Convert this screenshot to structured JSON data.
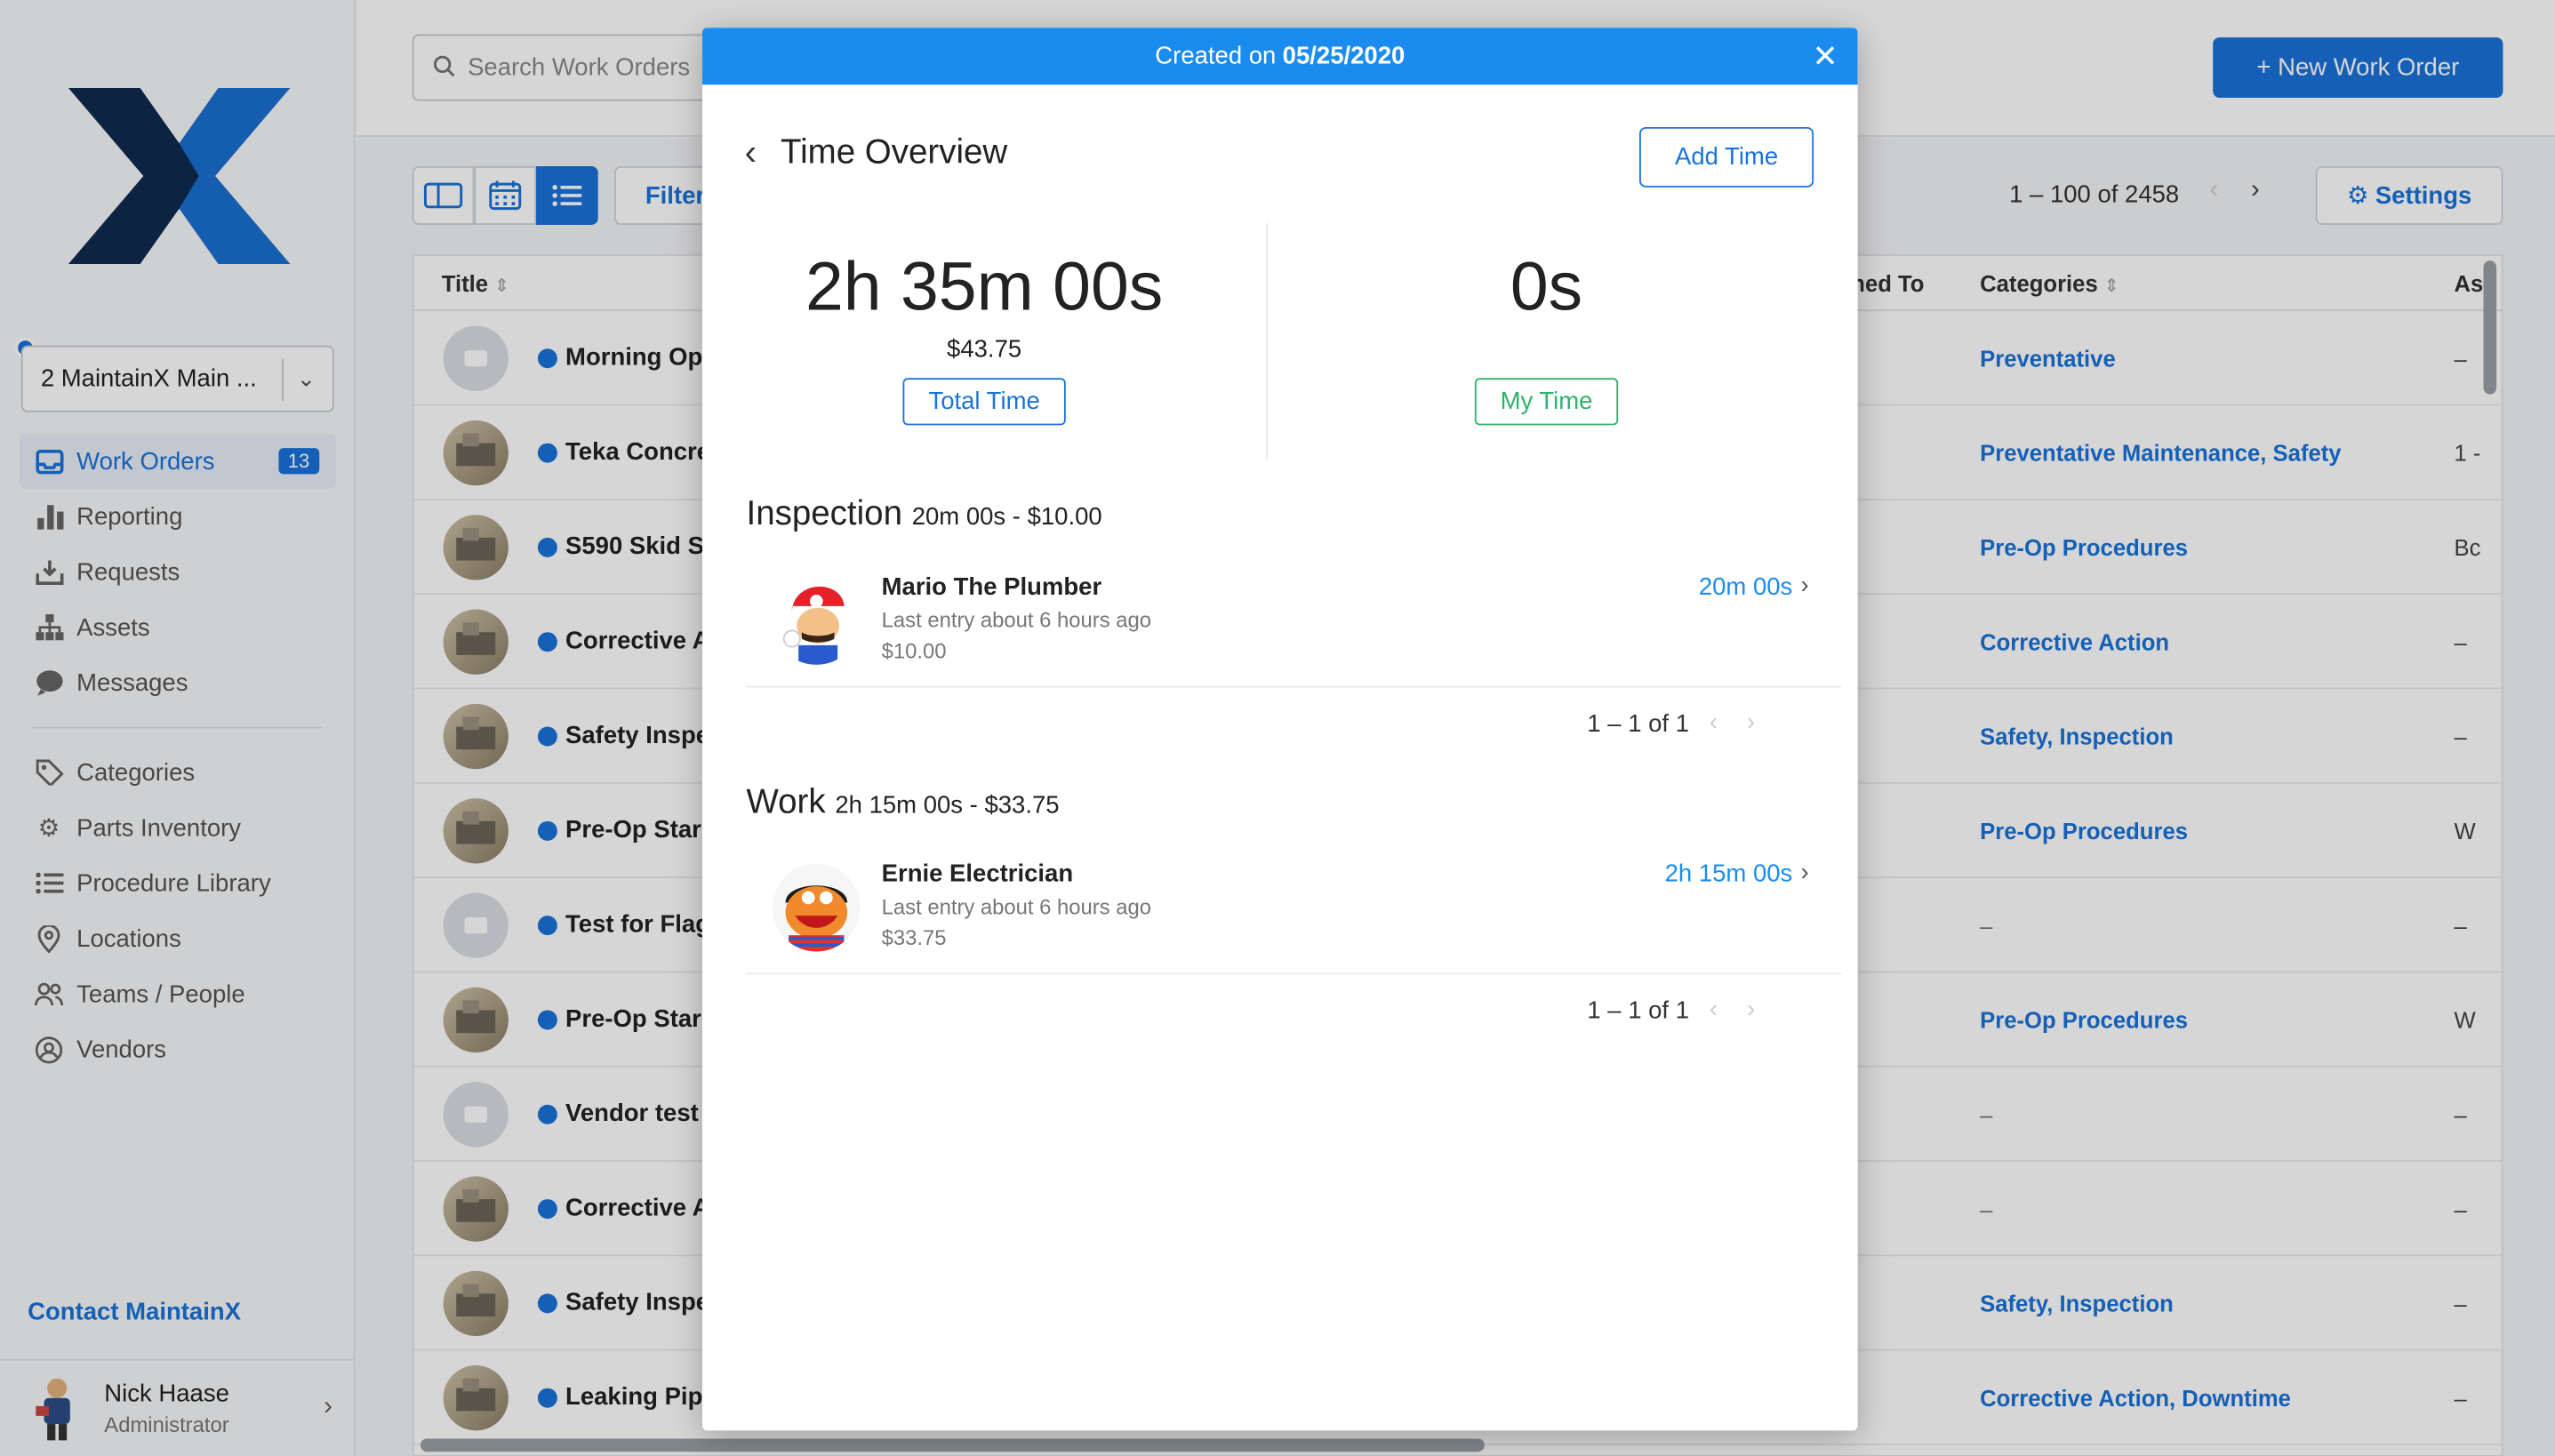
{
  "sidebar": {
    "org": "2 MaintainX Main ...",
    "nav": [
      {
        "label": "Work Orders",
        "icon": "inbox-icon",
        "badge": "13",
        "active": true
      },
      {
        "label": "Reporting",
        "icon": "bar-chart-icon"
      },
      {
        "label": "Requests",
        "icon": "tray-download-icon"
      },
      {
        "label": "Assets",
        "icon": "hierarchy-icon"
      },
      {
        "label": "Messages",
        "icon": "chat-bubble-icon"
      },
      {
        "label": "Categories",
        "icon": "tag-icon"
      },
      {
        "label": "Parts Inventory",
        "icon": "gear-icon"
      },
      {
        "label": "Procedure Library",
        "icon": "list-icon"
      },
      {
        "label": "Locations",
        "icon": "map-pin-icon"
      },
      {
        "label": "Teams / People",
        "icon": "people-icon"
      },
      {
        "label": "Vendors",
        "icon": "vendors-icon"
      }
    ],
    "contact": "Contact MaintainX",
    "user": {
      "name": "Nick Haase",
      "role": "Administrator"
    }
  },
  "topbar": {
    "search_placeholder": "Search Work Orders",
    "new_button": "+ New Work Order"
  },
  "toolbar": {
    "filters": "Filters",
    "pager": "1 – 100 of 2458",
    "settings": "Settings"
  },
  "table": {
    "headers": {
      "title": "Title",
      "assigned": "ned To",
      "categories": "Categories",
      "asset": "As"
    },
    "rows": [
      {
        "title": "Morning Op",
        "category": "Preventative",
        "asset": "–",
        "thumb": "placeholder"
      },
      {
        "title": "Teka Concre",
        "category": "Preventative Maintenance, Safety",
        "asset": "1 -",
        "thumb": "photo"
      },
      {
        "title": "S590 Skid S",
        "category": "Pre-Op Procedures",
        "asset": "Bc",
        "thumb": "photo"
      },
      {
        "title": "Corrective A",
        "category": "Corrective Action",
        "asset": "–",
        "thumb": "photo"
      },
      {
        "title": "Safety Inspe",
        "category": "Safety, Inspection",
        "asset": "–",
        "thumb": "photo"
      },
      {
        "title": "Pre-Op Star",
        "category": "Pre-Op Procedures",
        "asset": "W",
        "thumb": "photo"
      },
      {
        "title": "Test for Flag",
        "category": "–",
        "asset": "–",
        "thumb": "placeholder"
      },
      {
        "title": "Pre-Op Star",
        "category": "Pre-Op Procedures",
        "asset": "W",
        "thumb": "photo"
      },
      {
        "title": "Vendor test",
        "category": "–",
        "asset": "–",
        "thumb": "placeholder"
      },
      {
        "title": "Corrective A",
        "category": "–",
        "asset": "–",
        "thumb": "photo"
      },
      {
        "title": "Safety Inspe",
        "category": "Safety, Inspection",
        "asset": "–",
        "thumb": "photo"
      },
      {
        "title": "Leaking Pip",
        "category": "Corrective Action, Downtime",
        "asset": "–",
        "thumb": "photo"
      }
    ]
  },
  "modal": {
    "header_prefix": "Created on",
    "header_date": "05/25/2020",
    "title": "Time Overview",
    "add_time": "Add Time",
    "total": {
      "time": "2h 35m 00s",
      "cost": "$43.75",
      "label": "Total Time"
    },
    "mine": {
      "time": "0s",
      "label": "My Time"
    },
    "sections": [
      {
        "name": "Inspection",
        "summary": "20m 00s - $10.00",
        "entries": [
          {
            "name": "Mario The Plumber",
            "sub": "Last entry about 6 hours ago",
            "cost": "$10.00",
            "duration": "20m 00s"
          }
        ],
        "pager": "1 – 1 of 1"
      },
      {
        "name": "Work",
        "summary": "2h 15m 00s - $33.75",
        "entries": [
          {
            "name": "Ernie Electrician",
            "sub": "Last entry about 6 hours ago",
            "cost": "$33.75",
            "duration": "2h 15m 00s"
          }
        ],
        "pager": "1 – 1 of 1"
      }
    ]
  },
  "colors": {
    "accent": "#1a73d9",
    "header": "#1a8cf0",
    "green": "#2fb36c",
    "logo_dark": "#0f2a4f"
  }
}
